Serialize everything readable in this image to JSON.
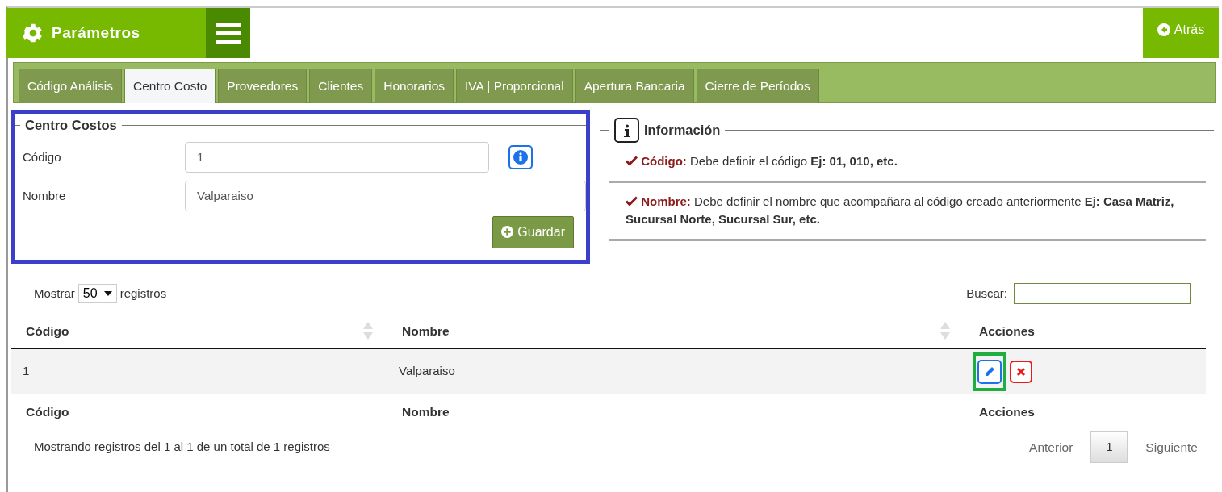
{
  "header": {
    "title": "Parámetros",
    "back_button": "Atrás"
  },
  "tabs": [
    {
      "label": "Código Análisis",
      "selected": false
    },
    {
      "label": "Centro Costo",
      "selected": true
    },
    {
      "label": "Proveedores",
      "selected": false
    },
    {
      "label": "Clientes",
      "selected": false
    },
    {
      "label": "Honorarios",
      "selected": false
    },
    {
      "label": "IVA | Proporcional",
      "selected": false
    },
    {
      "label": "Apertura Bancaria",
      "selected": false
    },
    {
      "label": "Cierre de Períodos",
      "selected": false
    }
  ],
  "form": {
    "legend": "Centro Costos",
    "fields": [
      {
        "label": "Código",
        "value": "1",
        "help": true
      },
      {
        "label": "Nombre",
        "value": "Valparaiso",
        "help": false
      }
    ],
    "save_button": "Guardar"
  },
  "info": {
    "title": "Información",
    "items": [
      {
        "label": "Código:",
        "text": "Debe definir el código **Ej: 01, 010, etc.**"
      },
      {
        "label": "Nombre:",
        "text": "Debe definir el nombre que acompañara al código creado anteriormente **Ej: Casa Matriz, Sucursal Norte, Sucursal Sur, etc.**"
      }
    ]
  },
  "table": {
    "length_before": "Mostrar",
    "length_value": "50",
    "length_after": "registros",
    "search_label": "Buscar:",
    "columns": [
      {
        "label": "Código",
        "sortable": true
      },
      {
        "label": "Nombre",
        "sortable": true
      },
      {
        "label": "Acciones",
        "sortable": false
      }
    ],
    "rows": [
      {
        "cells": [
          "1",
          "Valparaiso"
        ]
      }
    ],
    "footer_columns": [
      "Código",
      "Nombre",
      "Acciones"
    ],
    "info": "Mostrando registros del 1 al 1 de un total de 1 registros",
    "pagination": {
      "previous": "Anterior",
      "pages": [
        {
          "label": "1",
          "selected": true
        }
      ],
      "next": "Siguiente"
    }
  }
}
